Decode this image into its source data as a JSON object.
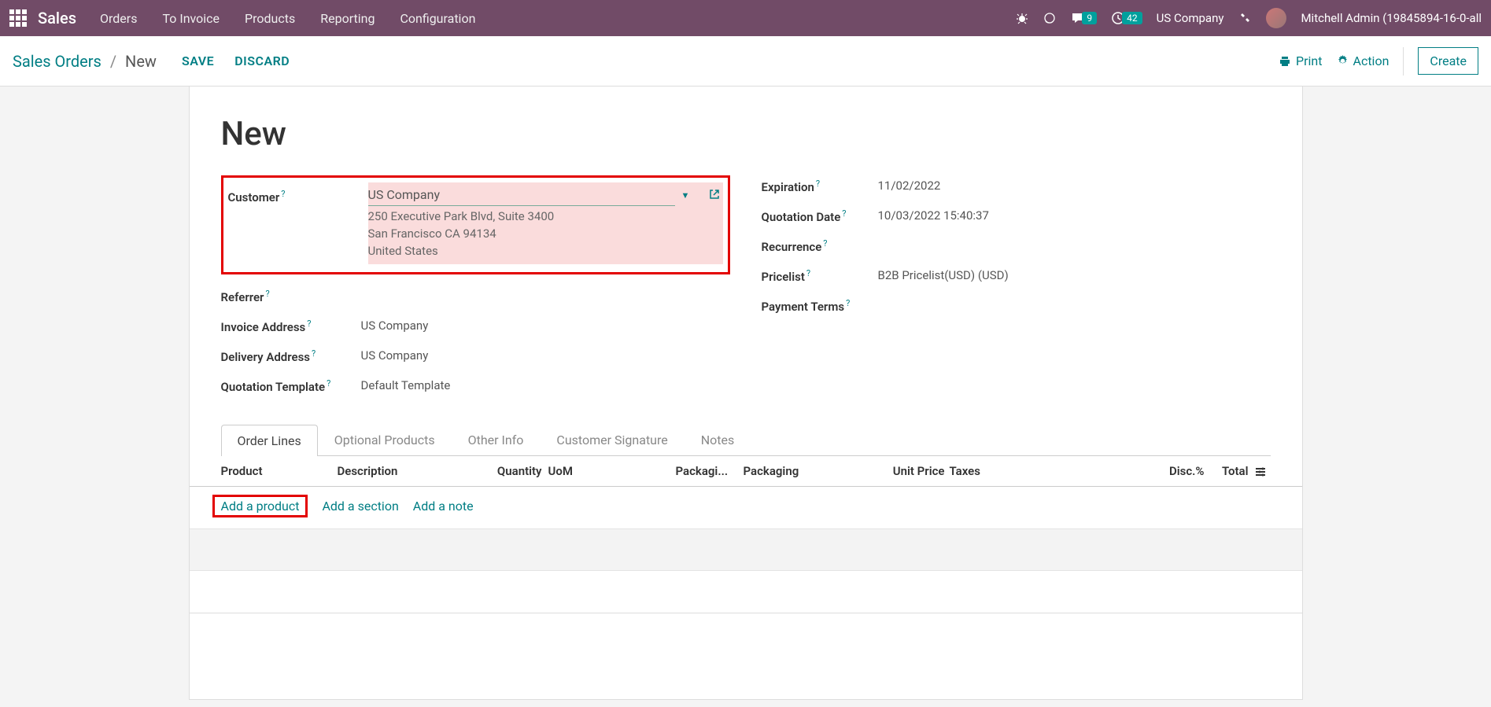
{
  "topbar": {
    "app": "Sales",
    "menu": [
      "Orders",
      "To Invoice",
      "Products",
      "Reporting",
      "Configuration"
    ],
    "messages_count": "9",
    "activities_count": "42",
    "company": "US Company",
    "user": "Mitchell Admin (19845894-16-0-all"
  },
  "breadcrumb": {
    "root": "Sales Orders",
    "current": "New"
  },
  "actions": {
    "save": "SAVE",
    "discard": "DISCARD",
    "print": "Print",
    "action": "Action",
    "create": "Create"
  },
  "form": {
    "title": "New",
    "left": {
      "customer_label": "Customer",
      "customer_value": "US Company",
      "customer_addr1": "250 Executive Park Blvd, Suite 3400",
      "customer_addr2": "San Francisco CA 94134",
      "customer_addr3": "United States",
      "referrer_label": "Referrer",
      "invoice_label": "Invoice Address",
      "invoice_value": "US Company",
      "delivery_label": "Delivery Address",
      "delivery_value": "US Company",
      "template_label": "Quotation Template",
      "template_value": "Default Template"
    },
    "right": {
      "expiration_label": "Expiration",
      "expiration_value": "11/02/2022",
      "qdate_label": "Quotation Date",
      "qdate_value": "10/03/2022 15:40:37",
      "recurrence_label": "Recurrence",
      "pricelist_label": "Pricelist",
      "pricelist_value": "B2B Pricelist(USD) (USD)",
      "terms_label": "Payment Terms"
    }
  },
  "tabs": [
    "Order Lines",
    "Optional Products",
    "Other Info",
    "Customer Signature",
    "Notes"
  ],
  "columns": {
    "product": "Product",
    "description": "Description",
    "quantity": "Quantity",
    "uom": "UoM",
    "packagi": "Packagi...",
    "packaging": "Packaging",
    "unit_price": "Unit Price",
    "taxes": "Taxes",
    "disc": "Disc.%",
    "total": "Total"
  },
  "addrow": {
    "product": "Add a product",
    "section": "Add a section",
    "note": "Add a note"
  }
}
